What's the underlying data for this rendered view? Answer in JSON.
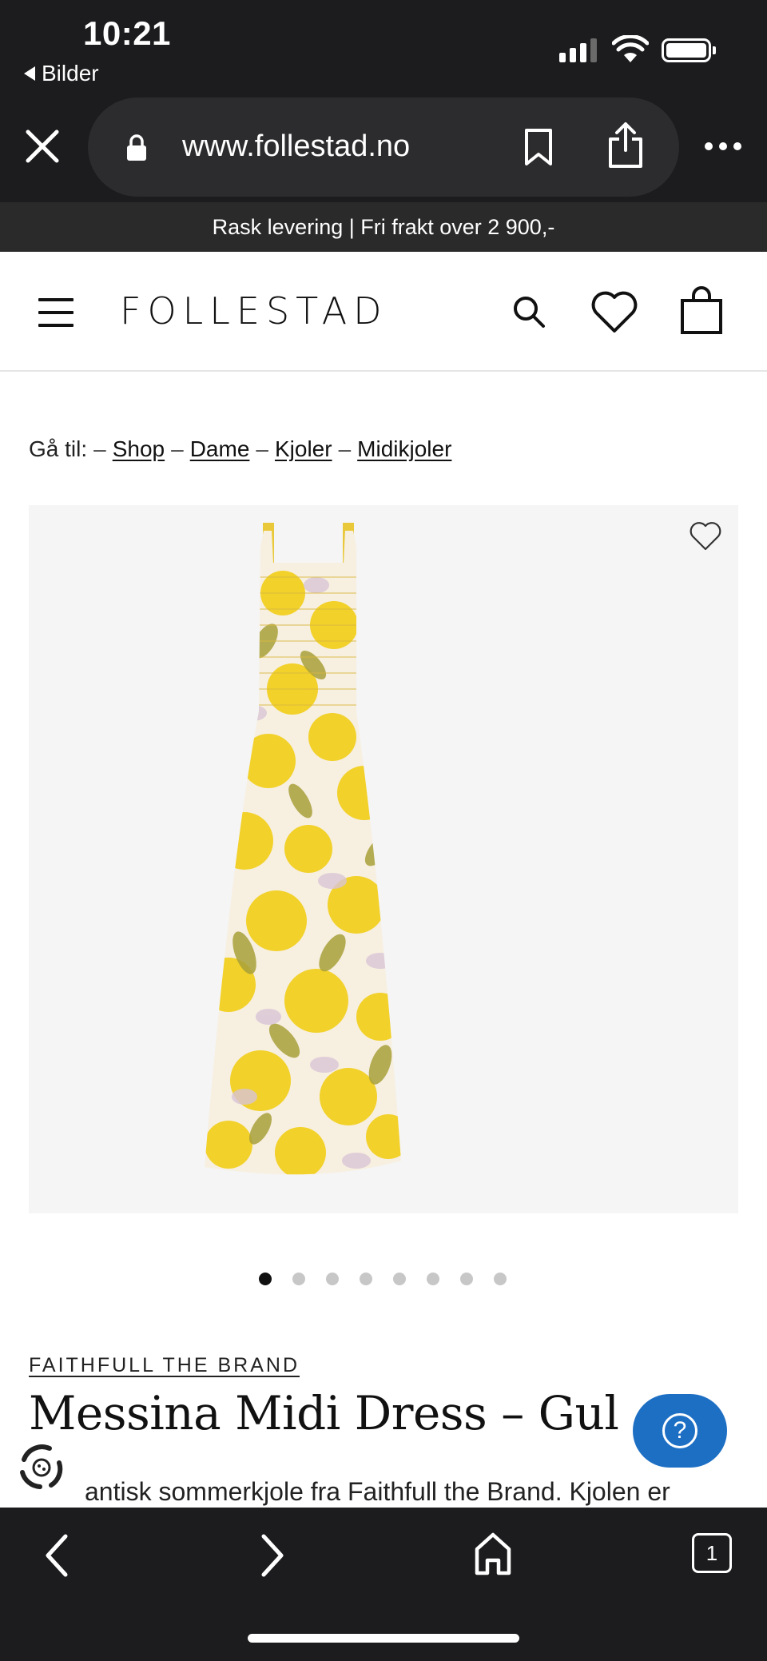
{
  "status_bar": {
    "time": "10:21",
    "back_app_label": "Bilder",
    "signal_bars": 4,
    "signal_bars_active": 3
  },
  "browser": {
    "url": "www.follestad.no",
    "icons": [
      "close-icon",
      "lock-icon",
      "bookmark-icon",
      "share-icon",
      "more-icon"
    ]
  },
  "promo": {
    "text": "Rask levering | Fri frakt over 2 900,-"
  },
  "header": {
    "logo": "FOLLESTAD",
    "icons": [
      "menu-icon",
      "search-icon",
      "heart-icon",
      "bag-icon"
    ]
  },
  "breadcrumb": {
    "prefix": "Gå til:",
    "separator": "–",
    "items": [
      "Shop",
      "Dame",
      "Kjoler",
      "Midikjoler"
    ]
  },
  "gallery": {
    "dot_count": 8,
    "active_index": 0,
    "colors": {
      "yellow": "#f2d12a",
      "cream": "#f7efe0",
      "olive": "#a9a03a",
      "lilac": "#d8c4d6",
      "bg": "#f5f5f5"
    }
  },
  "product": {
    "brand": "FAITHFULL THE BRAND",
    "title": "Messina Midi Dress – Gul",
    "description_visible": "antisk sommerkjole fra Faithfull the Brand. Kjolen er"
  },
  "help": {
    "label": "?"
  },
  "toolbar": {
    "tabs_count": "1",
    "icons": [
      "back-icon",
      "forward-icon",
      "home-icon",
      "tabs-icon"
    ]
  },
  "theme": {
    "chrome_bg": "#1c1c1e",
    "promo_bg": "#2a2a2a",
    "accent_blue": "#1d6fc4"
  }
}
